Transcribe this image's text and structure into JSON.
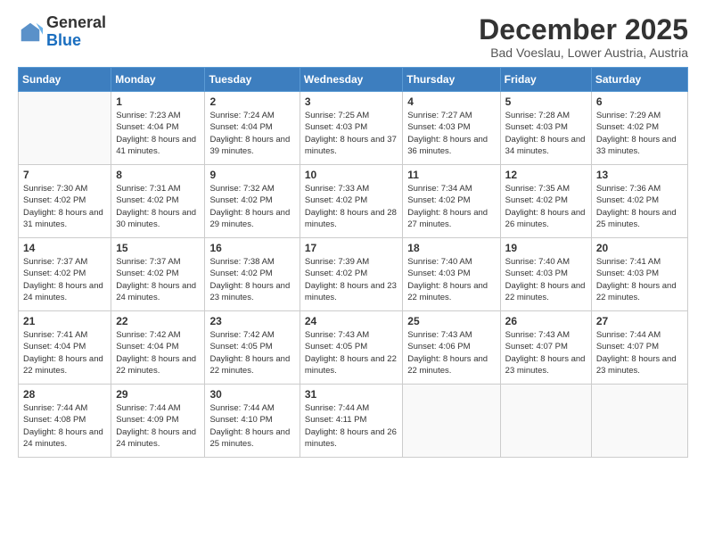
{
  "header": {
    "logo_general": "General",
    "logo_blue": "Blue",
    "month_title": "December 2025",
    "location": "Bad Voeslau, Lower Austria, Austria"
  },
  "calendar": {
    "days_of_week": [
      "Sunday",
      "Monday",
      "Tuesday",
      "Wednesday",
      "Thursday",
      "Friday",
      "Saturday"
    ],
    "weeks": [
      [
        {
          "day": "",
          "sunrise": "",
          "sunset": "",
          "daylight": ""
        },
        {
          "day": "1",
          "sunrise": "Sunrise: 7:23 AM",
          "sunset": "Sunset: 4:04 PM",
          "daylight": "Daylight: 8 hours and 41 minutes."
        },
        {
          "day": "2",
          "sunrise": "Sunrise: 7:24 AM",
          "sunset": "Sunset: 4:04 PM",
          "daylight": "Daylight: 8 hours and 39 minutes."
        },
        {
          "day": "3",
          "sunrise": "Sunrise: 7:25 AM",
          "sunset": "Sunset: 4:03 PM",
          "daylight": "Daylight: 8 hours and 37 minutes."
        },
        {
          "day": "4",
          "sunrise": "Sunrise: 7:27 AM",
          "sunset": "Sunset: 4:03 PM",
          "daylight": "Daylight: 8 hours and 36 minutes."
        },
        {
          "day": "5",
          "sunrise": "Sunrise: 7:28 AM",
          "sunset": "Sunset: 4:03 PM",
          "daylight": "Daylight: 8 hours and 34 minutes."
        },
        {
          "day": "6",
          "sunrise": "Sunrise: 7:29 AM",
          "sunset": "Sunset: 4:02 PM",
          "daylight": "Daylight: 8 hours and 33 minutes."
        }
      ],
      [
        {
          "day": "7",
          "sunrise": "Sunrise: 7:30 AM",
          "sunset": "Sunset: 4:02 PM",
          "daylight": "Daylight: 8 hours and 31 minutes."
        },
        {
          "day": "8",
          "sunrise": "Sunrise: 7:31 AM",
          "sunset": "Sunset: 4:02 PM",
          "daylight": "Daylight: 8 hours and 30 minutes."
        },
        {
          "day": "9",
          "sunrise": "Sunrise: 7:32 AM",
          "sunset": "Sunset: 4:02 PM",
          "daylight": "Daylight: 8 hours and 29 minutes."
        },
        {
          "day": "10",
          "sunrise": "Sunrise: 7:33 AM",
          "sunset": "Sunset: 4:02 PM",
          "daylight": "Daylight: 8 hours and 28 minutes."
        },
        {
          "day": "11",
          "sunrise": "Sunrise: 7:34 AM",
          "sunset": "Sunset: 4:02 PM",
          "daylight": "Daylight: 8 hours and 27 minutes."
        },
        {
          "day": "12",
          "sunrise": "Sunrise: 7:35 AM",
          "sunset": "Sunset: 4:02 PM",
          "daylight": "Daylight: 8 hours and 26 minutes."
        },
        {
          "day": "13",
          "sunrise": "Sunrise: 7:36 AM",
          "sunset": "Sunset: 4:02 PM",
          "daylight": "Daylight: 8 hours and 25 minutes."
        }
      ],
      [
        {
          "day": "14",
          "sunrise": "Sunrise: 7:37 AM",
          "sunset": "Sunset: 4:02 PM",
          "daylight": "Daylight: 8 hours and 24 minutes."
        },
        {
          "day": "15",
          "sunrise": "Sunrise: 7:37 AM",
          "sunset": "Sunset: 4:02 PM",
          "daylight": "Daylight: 8 hours and 24 minutes."
        },
        {
          "day": "16",
          "sunrise": "Sunrise: 7:38 AM",
          "sunset": "Sunset: 4:02 PM",
          "daylight": "Daylight: 8 hours and 23 minutes."
        },
        {
          "day": "17",
          "sunrise": "Sunrise: 7:39 AM",
          "sunset": "Sunset: 4:02 PM",
          "daylight": "Daylight: 8 hours and 23 minutes."
        },
        {
          "day": "18",
          "sunrise": "Sunrise: 7:40 AM",
          "sunset": "Sunset: 4:03 PM",
          "daylight": "Daylight: 8 hours and 22 minutes."
        },
        {
          "day": "19",
          "sunrise": "Sunrise: 7:40 AM",
          "sunset": "Sunset: 4:03 PM",
          "daylight": "Daylight: 8 hours and 22 minutes."
        },
        {
          "day": "20",
          "sunrise": "Sunrise: 7:41 AM",
          "sunset": "Sunset: 4:03 PM",
          "daylight": "Daylight: 8 hours and 22 minutes."
        }
      ],
      [
        {
          "day": "21",
          "sunrise": "Sunrise: 7:41 AM",
          "sunset": "Sunset: 4:04 PM",
          "daylight": "Daylight: 8 hours and 22 minutes."
        },
        {
          "day": "22",
          "sunrise": "Sunrise: 7:42 AM",
          "sunset": "Sunset: 4:04 PM",
          "daylight": "Daylight: 8 hours and 22 minutes."
        },
        {
          "day": "23",
          "sunrise": "Sunrise: 7:42 AM",
          "sunset": "Sunset: 4:05 PM",
          "daylight": "Daylight: 8 hours and 22 minutes."
        },
        {
          "day": "24",
          "sunrise": "Sunrise: 7:43 AM",
          "sunset": "Sunset: 4:05 PM",
          "daylight": "Daylight: 8 hours and 22 minutes."
        },
        {
          "day": "25",
          "sunrise": "Sunrise: 7:43 AM",
          "sunset": "Sunset: 4:06 PM",
          "daylight": "Daylight: 8 hours and 22 minutes."
        },
        {
          "day": "26",
          "sunrise": "Sunrise: 7:43 AM",
          "sunset": "Sunset: 4:07 PM",
          "daylight": "Daylight: 8 hours and 23 minutes."
        },
        {
          "day": "27",
          "sunrise": "Sunrise: 7:44 AM",
          "sunset": "Sunset: 4:07 PM",
          "daylight": "Daylight: 8 hours and 23 minutes."
        }
      ],
      [
        {
          "day": "28",
          "sunrise": "Sunrise: 7:44 AM",
          "sunset": "Sunset: 4:08 PM",
          "daylight": "Daylight: 8 hours and 24 minutes."
        },
        {
          "day": "29",
          "sunrise": "Sunrise: 7:44 AM",
          "sunset": "Sunset: 4:09 PM",
          "daylight": "Daylight: 8 hours and 24 minutes."
        },
        {
          "day": "30",
          "sunrise": "Sunrise: 7:44 AM",
          "sunset": "Sunset: 4:10 PM",
          "daylight": "Daylight: 8 hours and 25 minutes."
        },
        {
          "day": "31",
          "sunrise": "Sunrise: 7:44 AM",
          "sunset": "Sunset: 4:11 PM",
          "daylight": "Daylight: 8 hours and 26 minutes."
        },
        {
          "day": "",
          "sunrise": "",
          "sunset": "",
          "daylight": ""
        },
        {
          "day": "",
          "sunrise": "",
          "sunset": "",
          "daylight": ""
        },
        {
          "day": "",
          "sunrise": "",
          "sunset": "",
          "daylight": ""
        }
      ]
    ]
  }
}
